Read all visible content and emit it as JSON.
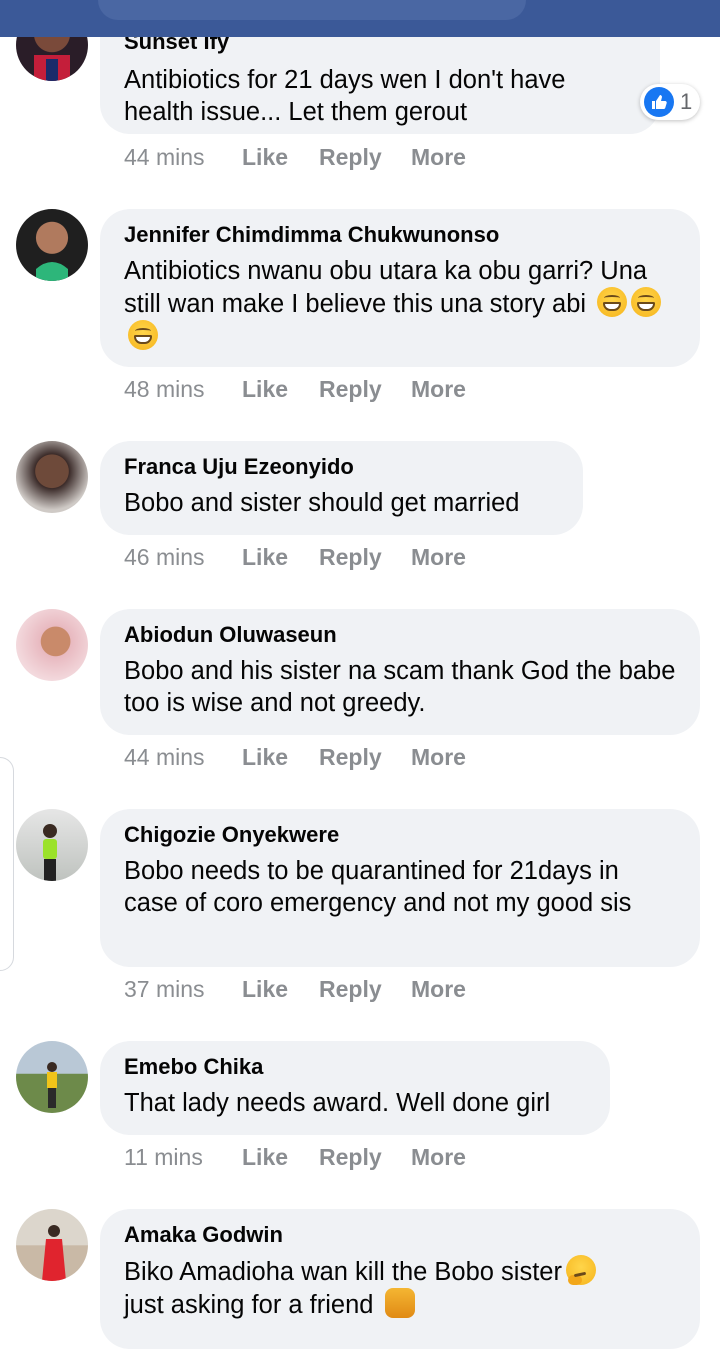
{
  "colors": {
    "header": "#3b5998",
    "bubble": "#f0f2f5",
    "meta": "#8a8d91",
    "like_blue": "#1877f2"
  },
  "actions": {
    "like": "Like",
    "reply": "Reply",
    "more": "More"
  },
  "comments": [
    {
      "name": "Sunset Ify",
      "text": "Antibiotics for 21 days wen I don't have health issue... Let them gerout",
      "time": "44 mins",
      "reactions": {
        "icon": "thumbs-up-icon",
        "count": "1"
      }
    },
    {
      "name": "Jennifer Chimdimma Chukwunonso",
      "text": "Antibiotics nwanu obu utara ka obu garri? Una still wan make I believe this una story abi",
      "emojis": [
        "grinning-face-icon",
        "grinning-face-icon",
        "grinning-face-icon"
      ],
      "time": "48 mins"
    },
    {
      "name": "Franca Uju Ezeonyido",
      "text": "Bobo and sister should get married",
      "time": "46 mins"
    },
    {
      "name": "Abiodun Oluwaseun",
      "text": "Bobo and his sister na scam thank God the babe too is wise and not greedy.",
      "time": "44 mins"
    },
    {
      "name": "Chigozie Onyekwere",
      "text": "Bobo needs to be quarantined for 21days in case of coro emergency and not my good sis",
      "time": "37 mins"
    },
    {
      "name": "Emebo Chika",
      "text": "That lady needs award. Well done girl",
      "time": "11 mins"
    },
    {
      "name": "Amaka Godwin",
      "text": "Biko Amadioha wan kill the Bobo sister",
      "text2": "just asking for a friend",
      "emojis": [
        "thinking-face-icon",
        "shrugging-person-icon"
      ]
    }
  ]
}
